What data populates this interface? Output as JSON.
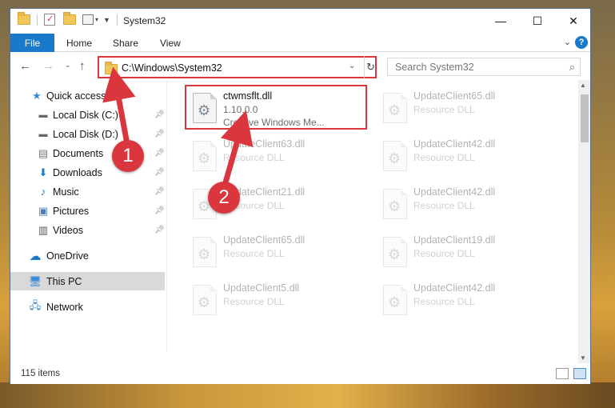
{
  "window": {
    "title": "System32",
    "minimize_glyph": "—",
    "maximize_glyph": "☐",
    "close_glyph": "✕"
  },
  "ribbon": {
    "file_tab": "File",
    "tabs": [
      "Home",
      "Share",
      "View"
    ],
    "help_glyph": "?"
  },
  "nav": {
    "address_path": "C:\\Windows\\System32",
    "search_placeholder": "Search System32"
  },
  "sidebar": {
    "items": [
      {
        "label": "Quick access",
        "icon": "star-icon"
      },
      {
        "label": "Local Disk (C:)",
        "icon": "drive-icon",
        "pinned": true
      },
      {
        "label": "Local Disk (D:)",
        "icon": "drive-icon",
        "pinned": true
      },
      {
        "label": "Documents",
        "icon": "documents-icon",
        "pinned": true
      },
      {
        "label": "Downloads",
        "icon": "download-icon",
        "pinned": true
      },
      {
        "label": "Music",
        "icon": "music-icon",
        "pinned": true
      },
      {
        "label": "Pictures",
        "icon": "pictures-icon",
        "pinned": true
      },
      {
        "label": "Videos",
        "icon": "videos-icon",
        "pinned": true
      },
      {
        "label": "OneDrive",
        "icon": "cloud-icon"
      },
      {
        "label": "This PC",
        "icon": "computer-icon",
        "selected": true
      },
      {
        "label": "Network",
        "icon": "network-icon"
      }
    ]
  },
  "files": [
    {
      "name": "ctwmsflt.dll",
      "meta1": "1.10.0.0",
      "meta2": "Creative Windows Me...",
      "highlighted": true
    },
    {
      "name": "UpdateClient65.dll",
      "meta1": "Resource DLL"
    },
    {
      "name": "UpdateClient63.dll",
      "meta1": "Resource DLL"
    },
    {
      "name": "UpdateClient42.dll",
      "meta1": "Resource DLL"
    },
    {
      "name": "UpdateClient21.dll",
      "meta1": "Resource DLL"
    },
    {
      "name": "UpdateClient42.dll",
      "meta1": "Resource DLL"
    },
    {
      "name": "UpdateClient65.dll",
      "meta1": "Resource DLL"
    },
    {
      "name": "UpdateClient19.dll",
      "meta1": "Resource DLL"
    },
    {
      "name": "UpdateClient5.dll",
      "meta1": "Resource DLL"
    },
    {
      "name": "UpdateClient42.dll",
      "meta1": "Resource DLL"
    }
  ],
  "status": {
    "item_count": "115 items"
  },
  "annotations": {
    "step1": "1",
    "step2": "2"
  },
  "colors": {
    "accent": "#1979ca",
    "annotation_red": "#d9363e"
  }
}
